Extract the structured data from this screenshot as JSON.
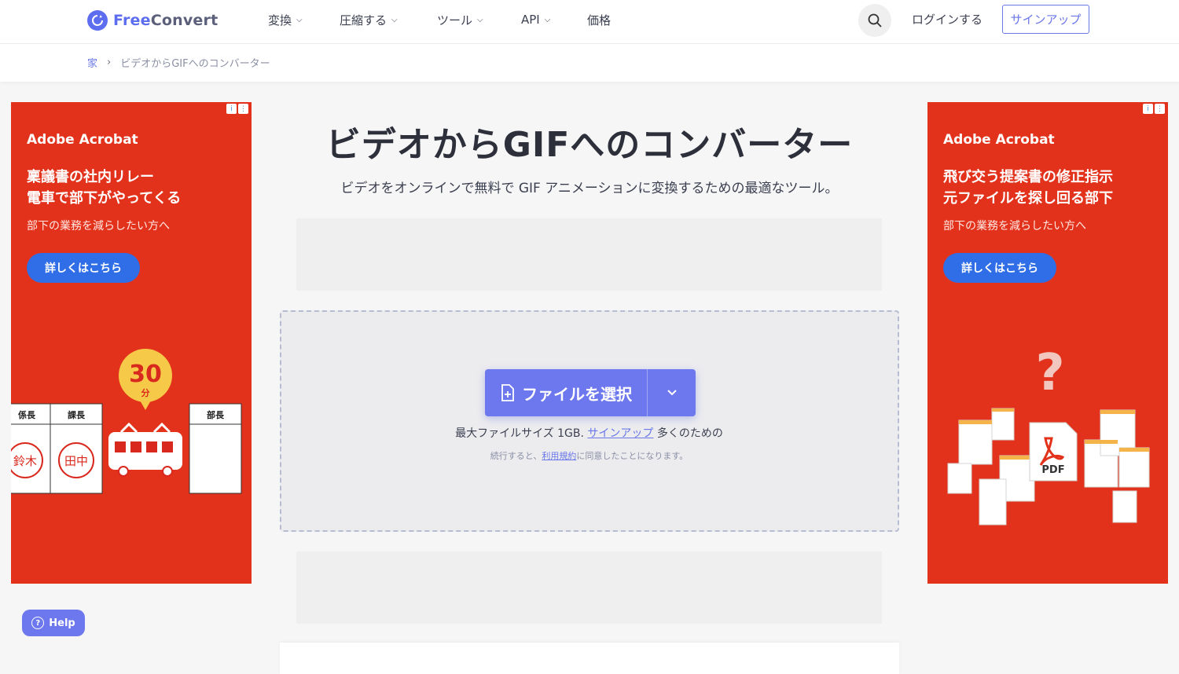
{
  "header": {
    "logo_free": "Free",
    "logo_convert": "Convert",
    "nav": [
      {
        "label": "変換",
        "has_dropdown": true
      },
      {
        "label": "圧縮する",
        "has_dropdown": true
      },
      {
        "label": "ツール",
        "has_dropdown": true
      },
      {
        "label": "API",
        "has_dropdown": true
      },
      {
        "label": "価格",
        "has_dropdown": false
      }
    ],
    "login": "ログインする",
    "signup": "サインアップ"
  },
  "breadcrumb": {
    "home": "家",
    "current": "ビデオからGIFへのコンバーター"
  },
  "main": {
    "title": "ビデオからGIFへのコンバーター",
    "subtitle": "ビデオをオンラインで無料で GIF アニメーションに変換するための最適なツール。",
    "choose_file": "ファイルを選択",
    "max_size_prefix": "最大ファイルサイズ 1GB.",
    "max_size_link": "サインアップ",
    "max_size_suffix": "多くのための",
    "terms_prefix": "続行すると、",
    "terms_link": "利用規約",
    "terms_suffix": "に同意したことになります。"
  },
  "ads": {
    "left": {
      "brand": "Adobe Acrobat",
      "headline_1": "稟議書の社内リレー",
      "headline_2": "電車で部下がやってくる",
      "sub": "部下の業務を減らしたい方へ",
      "cta": "詳しくはこちら",
      "badge_num": "30",
      "badge_unit": "分",
      "stamp_1": "係長",
      "stamp_2": "課長",
      "stamp_3": "部長",
      "seal_1": "鈴木",
      "seal_2": "田中"
    },
    "right": {
      "brand": "Adobe Acrobat",
      "headline_1": "飛び交う提案書の修正指示",
      "headline_2": "元ファイルを探し回る部下",
      "sub": "部下の業務を減らしたい方へ",
      "cta": "詳しくはこちら",
      "pdf_label": "PDF"
    }
  },
  "help": {
    "label": "Help"
  },
  "colors": {
    "accent": "#6e78ee",
    "ad_red": "#e3321b",
    "ad_button": "#2f6ee6"
  }
}
